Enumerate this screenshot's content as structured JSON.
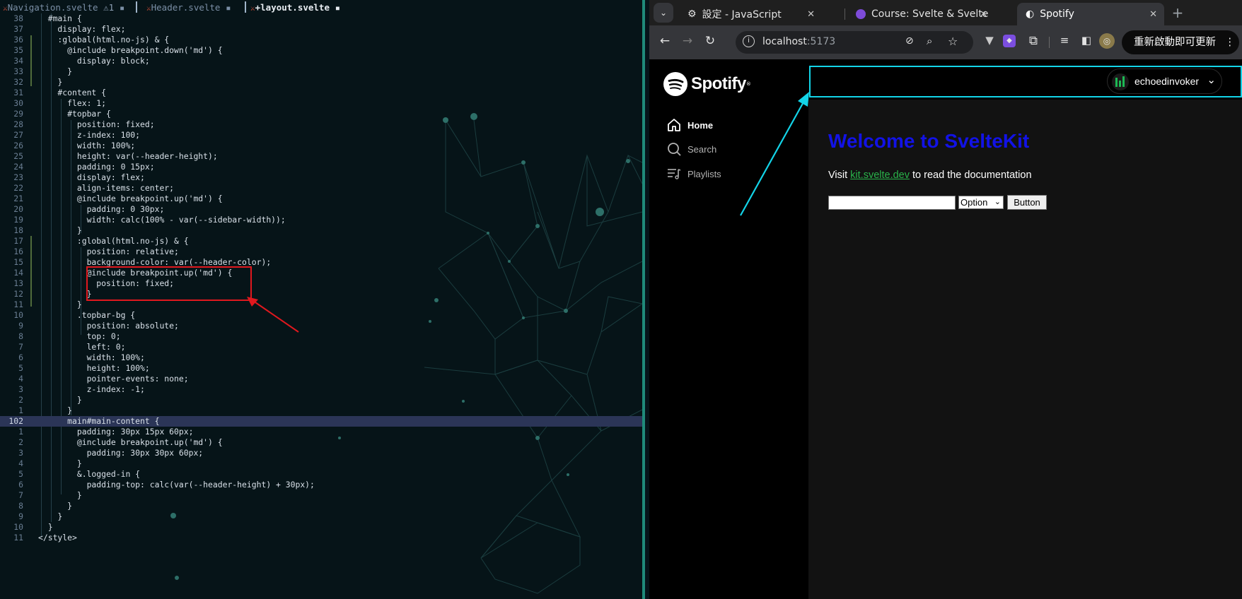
{
  "editor": {
    "tabs": [
      {
        "label": "Navigation.svelte",
        "warn": "⚠1",
        "marker": "▪"
      },
      {
        "label": "Header.svelte",
        "marker": "▪"
      },
      {
        "label": "+layout.svelte",
        "marker": "▪"
      }
    ],
    "lines": [
      {
        "n": "38",
        "t": "  #main {"
      },
      {
        "n": "37",
        "t": "    display: flex;"
      },
      {
        "n": "36",
        "t": "    :global(html.no-js) & {"
      },
      {
        "n": "35",
        "t": "      @include breakpoint.down('md') {"
      },
      {
        "n": "34",
        "t": "        display: block;"
      },
      {
        "n": "33",
        "t": "      }"
      },
      {
        "n": "32",
        "t": "    }"
      },
      {
        "n": "31",
        "t": "    #content {"
      },
      {
        "n": "30",
        "t": "      flex: 1;"
      },
      {
        "n": "29",
        "t": "      #topbar {"
      },
      {
        "n": "28",
        "t": "        position: fixed;"
      },
      {
        "n": "27",
        "t": "        z-index: 100;"
      },
      {
        "n": "26",
        "t": "        width: 100%;"
      },
      {
        "n": "25",
        "t": "        height: var(--header-height);"
      },
      {
        "n": "24",
        "t": "        padding: 0 15px;"
      },
      {
        "n": "23",
        "t": "        display: flex;"
      },
      {
        "n": "22",
        "t": "        align-items: center;"
      },
      {
        "n": "21",
        "t": "        @include breakpoint.up('md') {"
      },
      {
        "n": "20",
        "t": "          padding: 0 30px;"
      },
      {
        "n": "19",
        "t": "          width: calc(100% - var(--sidebar-width));"
      },
      {
        "n": "18",
        "t": "        }"
      },
      {
        "n": "17",
        "t": "        :global(html.no-js) & {"
      },
      {
        "n": "16",
        "t": "          position: relative;"
      },
      {
        "n": "15",
        "t": "          background-color: var(--header-color);"
      },
      {
        "n": "14",
        "t": "          @include breakpoint.up('md') {"
      },
      {
        "n": "13",
        "t": "            position: fixed;"
      },
      {
        "n": "12",
        "t": "          }"
      },
      {
        "n": "11",
        "t": "        }"
      },
      {
        "n": "10",
        "t": "        .topbar-bg {"
      },
      {
        "n": "9",
        "t": "          position: absolute;"
      },
      {
        "n": "8",
        "t": "          top: 0;"
      },
      {
        "n": "7",
        "t": "          left: 0;"
      },
      {
        "n": "6",
        "t": "          width: 100%;"
      },
      {
        "n": "5",
        "t": "          height: 100%;"
      },
      {
        "n": "4",
        "t": "          pointer-events: none;"
      },
      {
        "n": "3",
        "t": "          z-index: -1;"
      },
      {
        "n": "2",
        "t": "        }"
      },
      {
        "n": "1",
        "t": "      }"
      },
      {
        "n": "102",
        "t": "      main#main-content {",
        "current": true
      },
      {
        "n": "1",
        "t": "        padding: 30px 15px 60px;"
      },
      {
        "n": "2",
        "t": "        @include breakpoint.up('md') {"
      },
      {
        "n": "3",
        "t": "          padding: 30px 30px 60px;"
      },
      {
        "n": "4",
        "t": "        }"
      },
      {
        "n": "5",
        "t": "        &.logged-in {"
      },
      {
        "n": "6",
        "t": "          padding-top: calc(var(--header-height) + 30px);"
      },
      {
        "n": "7",
        "t": "        }"
      },
      {
        "n": "8",
        "t": "      }"
      },
      {
        "n": "9",
        "t": "    }"
      },
      {
        "n": "10",
        "t": "  }"
      },
      {
        "n": "11",
        "t": "</style>"
      }
    ]
  },
  "browser": {
    "tabs": [
      {
        "title": "設定 - JavaScript",
        "icon": "gear-icon"
      },
      {
        "title": "Course: Svelte & SvelteKit",
        "icon": "course-icon"
      },
      {
        "title": "Spotify",
        "icon": "globe-icon",
        "active": true
      }
    ],
    "new_tab": "+",
    "close": "✕",
    "url_host": "localhost",
    "url_port": ":5173",
    "update_label": "重新啟動即可更新"
  },
  "page": {
    "logo": "Spotify",
    "nav": [
      {
        "label": "Home",
        "icon": "home-icon",
        "active": true
      },
      {
        "label": "Search",
        "icon": "search-icon"
      },
      {
        "label": "Playlists",
        "icon": "playlist-icon"
      }
    ],
    "username": "echoedinvoker",
    "welcome": "Welcome to SvelteKit",
    "visit_prefix": "Visit ",
    "visit_link": "kit.svelte.dev",
    "visit_suffix": " to read the documentation",
    "select_value": "Option",
    "button_label": "Button"
  },
  "colors": {
    "annotation_red": "#e0181e",
    "annotation_cyan": "#13d4e8",
    "welcome_blue": "#1212e6",
    "link_green": "#29b34a"
  }
}
